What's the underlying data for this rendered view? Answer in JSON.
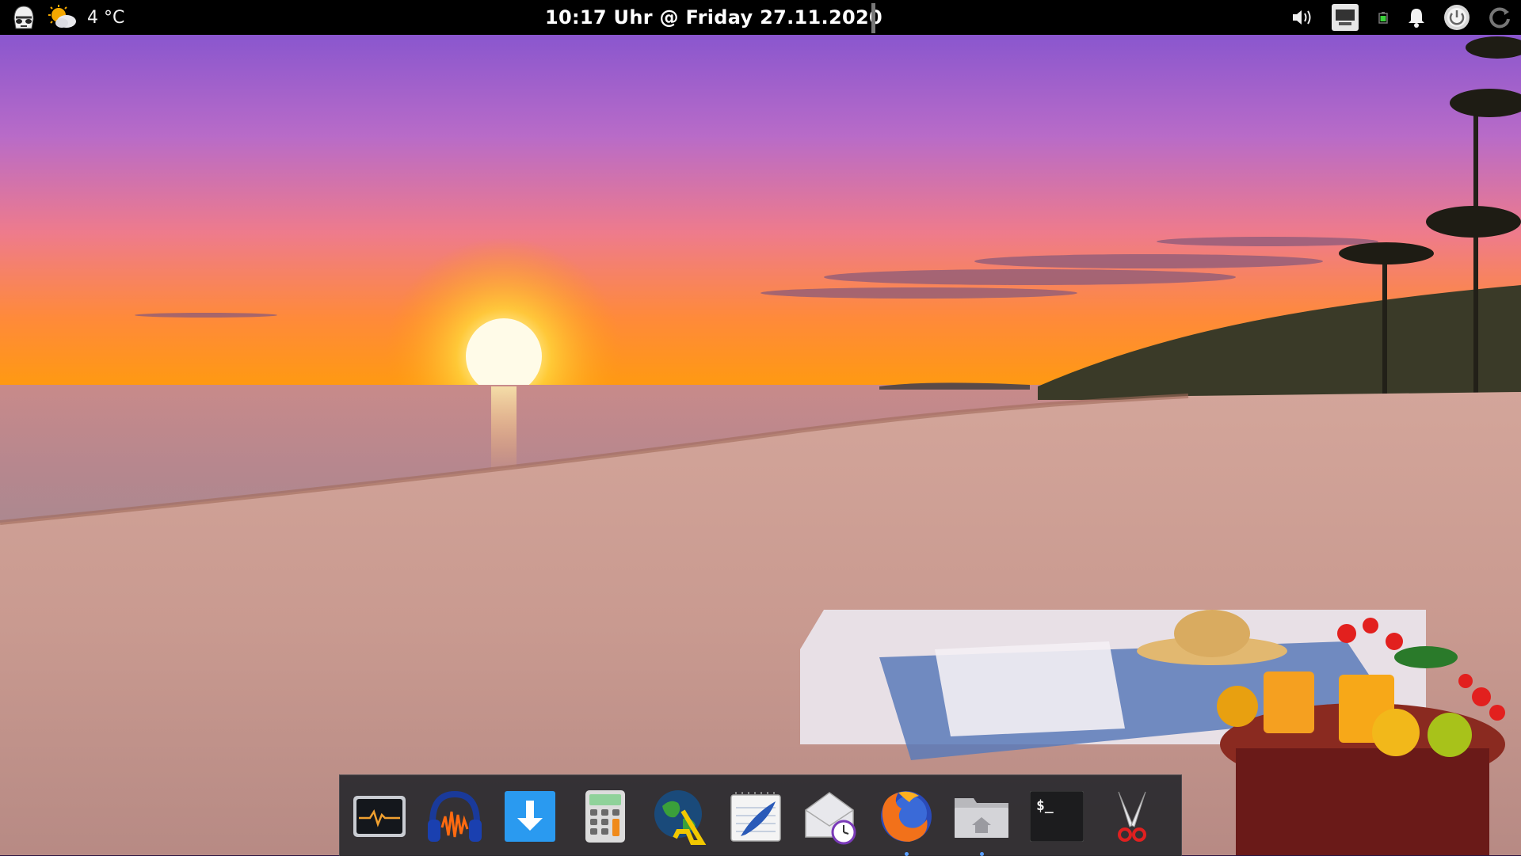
{
  "top_panel": {
    "weather_temperature": "4 °C",
    "clock_text": "10:17 Uhr @ Friday 27.11.2020",
    "tray_icons": [
      "volume-icon",
      "network-icon",
      "battery-icon",
      "notification-bell-icon",
      "power-icon",
      "refresh-icon"
    ]
  },
  "dock": {
    "items": [
      {
        "icon": "system-monitor-icon"
      },
      {
        "icon": "audio-editor-icon"
      },
      {
        "icon": "download-icon"
      },
      {
        "icon": "calculator-icon"
      },
      {
        "icon": "web-globe-icon"
      },
      {
        "icon": "text-editor-icon"
      },
      {
        "icon": "mail-scheduler-icon"
      },
      {
        "icon": "firefox-icon",
        "running": true
      },
      {
        "icon": "home-folder-icon",
        "running": true
      },
      {
        "icon": "terminal-icon",
        "terminal_prompt": "$_"
      },
      {
        "icon": "screenshot-scissors-icon"
      }
    ]
  },
  "colors": {
    "panel_bg": "#000000",
    "sky_top": "#7a4fd0",
    "sky_mid": "#e86a8a",
    "horizon": "#ff9a1a",
    "sand": "#c99a8e"
  }
}
